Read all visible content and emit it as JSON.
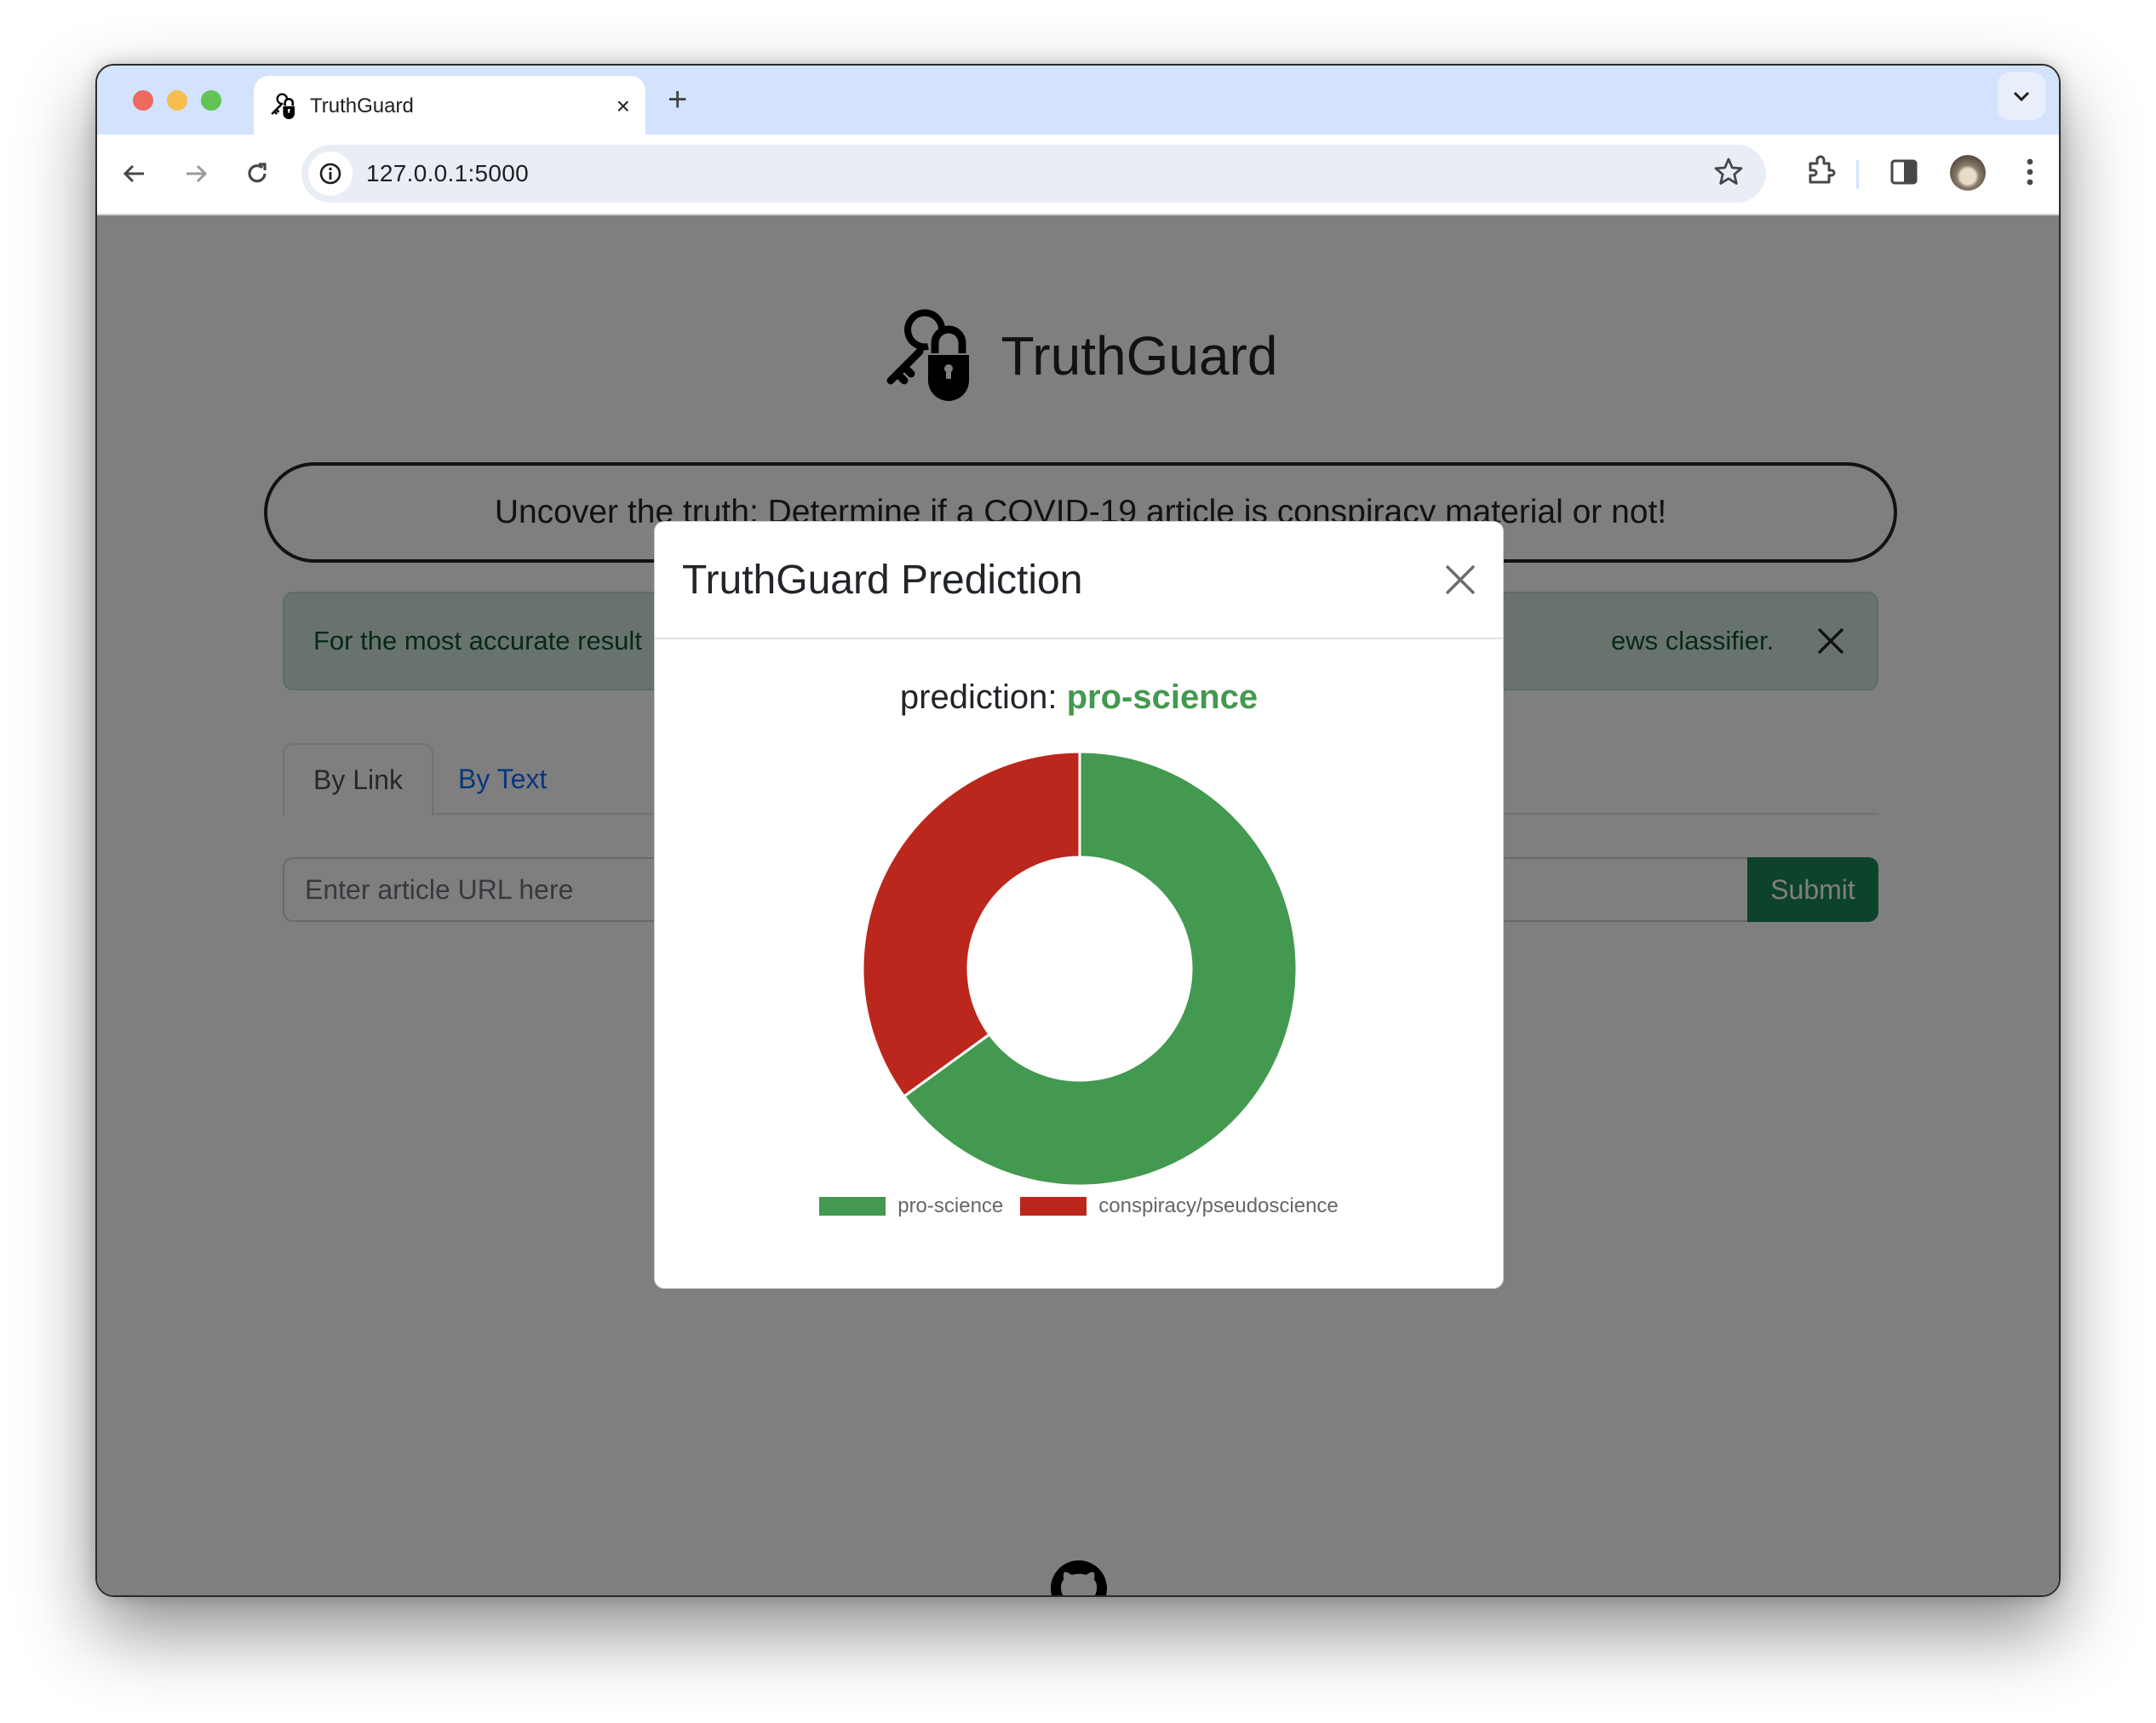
{
  "browser": {
    "tab_title": "TruthGuard",
    "tab_close": "×",
    "new_tab": "+",
    "url": "127.0.0.1:5000",
    "icons": [
      "back-arrow-icon",
      "forward-arrow-icon",
      "reload-icon",
      "site-info-icon",
      "bookmark-star-icon",
      "extensions-puzzle-icon",
      "side-panel-icon",
      "profile-avatar",
      "more-vert-icon",
      "tab-search-chevron-icon"
    ]
  },
  "page": {
    "brand_title": "TruthGuard",
    "hero_text": "Uncover the truth: Determine if a COVID-19 article is conspiracy material or not!",
    "alert": {
      "text_left": "For the most accurate result",
      "text_right": "ews classifier.",
      "text": "For the most accurate result… ews classifier."
    },
    "tabs": [
      {
        "label": "By Link",
        "active": true
      },
      {
        "label": "By Text",
        "active": false
      }
    ],
    "url_input": {
      "placeholder": "Enter article URL here",
      "value": ""
    },
    "submit_label": "Submit",
    "footer_icon": "github-icon"
  },
  "modal": {
    "title": "TruthGuard Prediction",
    "prediction_label": "prediction:",
    "prediction_value": "pro-science",
    "prediction_color": "#43994f"
  },
  "chart_data": {
    "type": "pie",
    "variant": "doughnut",
    "title": "",
    "categories": [
      "pro-science",
      "conspiracy/pseudoscience"
    ],
    "values": [
      65,
      35
    ],
    "unit": "percent (estimated from slice angle)",
    "colors": [
      "#43994f",
      "#bb271d"
    ],
    "legend": {
      "position": "bottom",
      "entries": [
        "pro-science",
        "conspiracy/pseudoscience"
      ]
    },
    "start_angle": "top",
    "direction": "clockwise"
  }
}
